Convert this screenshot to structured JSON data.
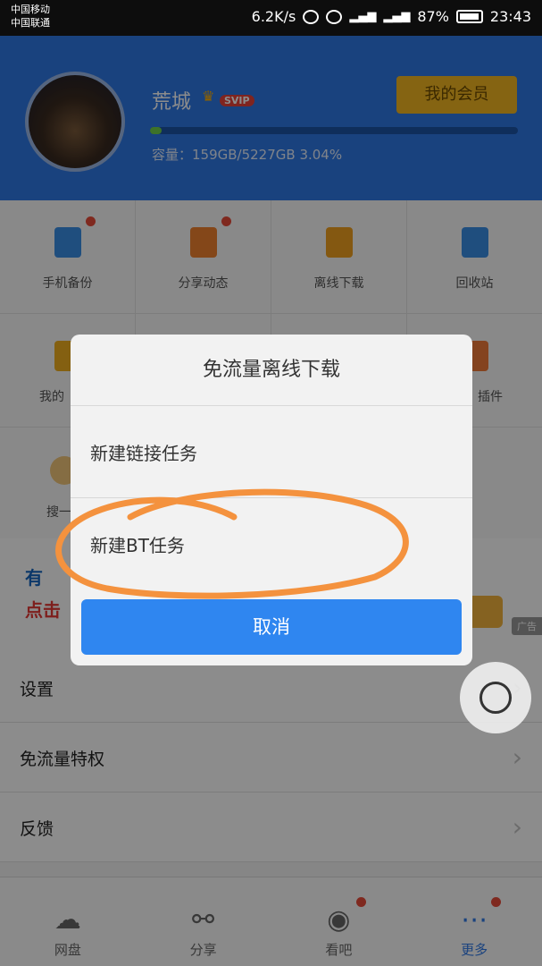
{
  "status_bar": {
    "carrier_1": "中国移动",
    "carrier_2": "中国联通",
    "speed": "6.2K/s",
    "battery": "87%",
    "time": "23:43"
  },
  "header": {
    "username": "荒城",
    "badge": "SVIP",
    "vip_button": "我的会员",
    "storage_text": "容量：159GB/5227GB 3.04%",
    "storage_used_fraction": 0.0304
  },
  "grid": [
    {
      "label": "手机备份",
      "icon": "phone-backup-icon",
      "color": "#3a8ee6",
      "badge": true
    },
    {
      "label": "分享动态",
      "icon": "flame-icon",
      "color": "#f0812f",
      "badge": true
    },
    {
      "label": "离线下载",
      "icon": "download-icon",
      "color": "#f0a020",
      "badge": false
    },
    {
      "label": "回收站",
      "icon": "trash-icon",
      "color": "#3a8ee6",
      "badge": false
    },
    {
      "label": "我的",
      "icon": "crown-icon",
      "color": "#f0b020",
      "badge": false
    },
    {
      "label": "",
      "icon": "",
      "color": "#fafafa",
      "badge": false
    },
    {
      "label": "",
      "icon": "",
      "color": "#fafafa",
      "badge": false
    },
    {
      "label": "插件",
      "icon": "plugin-icon",
      "color": "#f07a3a",
      "badge": false
    },
    {
      "label": "搜一",
      "icon": "coin-icon",
      "color": "#f3c77a",
      "badge": false
    },
    {
      "label": "",
      "icon": "",
      "color": "#fafafa",
      "badge": false
    },
    {
      "label": "",
      "icon": "",
      "color": "#fafafa",
      "badge": false
    },
    {
      "label": "",
      "icon": "",
      "color": "#fafafa",
      "badge": false
    }
  ],
  "banner": {
    "line1": "有",
    "line2": "点击",
    "ad_tag": "广告"
  },
  "settings": [
    {
      "label": "设置"
    },
    {
      "label": "免流量特权"
    },
    {
      "label": "反馈"
    }
  ],
  "tabs": [
    {
      "label": "网盘",
      "icon": "cloud-icon",
      "glyph": "☁",
      "active": false,
      "badge": false
    },
    {
      "label": "分享",
      "icon": "share-icon",
      "glyph": "⚯",
      "active": false,
      "badge": false
    },
    {
      "label": "看吧",
      "icon": "eye-icon",
      "glyph": "◉",
      "active": false,
      "badge": true
    },
    {
      "label": "更多",
      "icon": "more-icon",
      "glyph": "⋯",
      "active": true,
      "badge": true
    }
  ],
  "dialog": {
    "title": "免流量离线下载",
    "items": [
      "新建链接任务",
      "新建BT任务"
    ],
    "cancel": "取消"
  },
  "colors": {
    "brand_blue": "#2f78e6",
    "vip_gold": "#f3b622",
    "badge_red": "#e84b3a",
    "annotation_orange": "#f4923e"
  }
}
